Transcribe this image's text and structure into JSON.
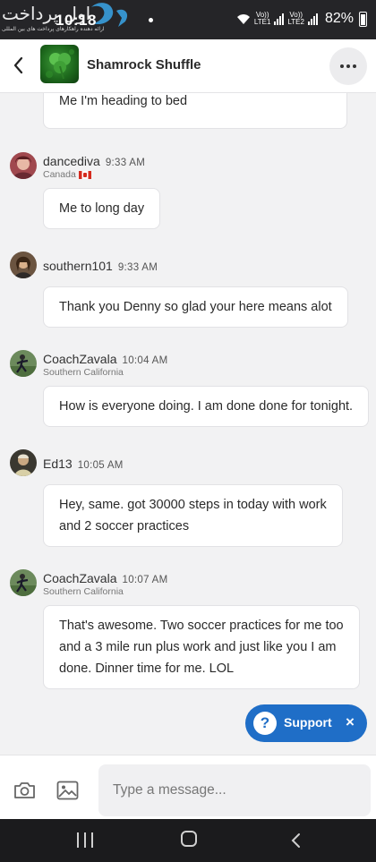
{
  "status_bar": {
    "time": "10:18",
    "battery": "82%",
    "sim1": "LTE1",
    "sim2": "LTE2",
    "volte": "Vo))"
  },
  "header": {
    "title": "Shamrock Shuffle",
    "back_icon": "chevron-left-icon",
    "more_icon": "more-horizontal-icon"
  },
  "messages": [
    {
      "id": "partial",
      "user": "",
      "time": "",
      "location": "",
      "lines": [
        "Me I'm heading to bed"
      ]
    },
    {
      "id": "m1",
      "user": "dancediva",
      "time": "9:33 AM",
      "location": "Canada",
      "lines": [
        "Me to long day"
      ]
    },
    {
      "id": "m2",
      "user": "southern101",
      "time": "9:33 AM",
      "location": "",
      "lines": [
        "Thank you Denny so glad your here means alot"
      ]
    },
    {
      "id": "m3",
      "user": "CoachZavala",
      "time": "10:04 AM",
      "location": "Southern California",
      "lines": [
        "How is everyone doing. I am done done for tonight."
      ]
    },
    {
      "id": "m4",
      "user": "Ed13",
      "time": "10:05 AM",
      "location": "",
      "lines": [
        "Hey, same. got 30000 steps in today with work",
        "and 2 soccer practices"
      ]
    },
    {
      "id": "m5",
      "user": "CoachZavala",
      "time": "10:07 AM",
      "location": "Southern California",
      "lines": [
        "That's awesome.  Two soccer practices for me too",
        "and a 3 mile run plus work and just like you I am",
        "done.  Dinner time for me.  LOL"
      ]
    }
  ],
  "support": {
    "label": "Support",
    "icon": "question-icon",
    "close": "×"
  },
  "composer": {
    "placeholder": "Type a message...",
    "camera_icon": "camera-icon",
    "gallery_icon": "image-icon"
  },
  "colors": {
    "accent": "#1f6ec7",
    "status_bar": "#252528",
    "nav_bar": "#1b1b1d"
  }
}
